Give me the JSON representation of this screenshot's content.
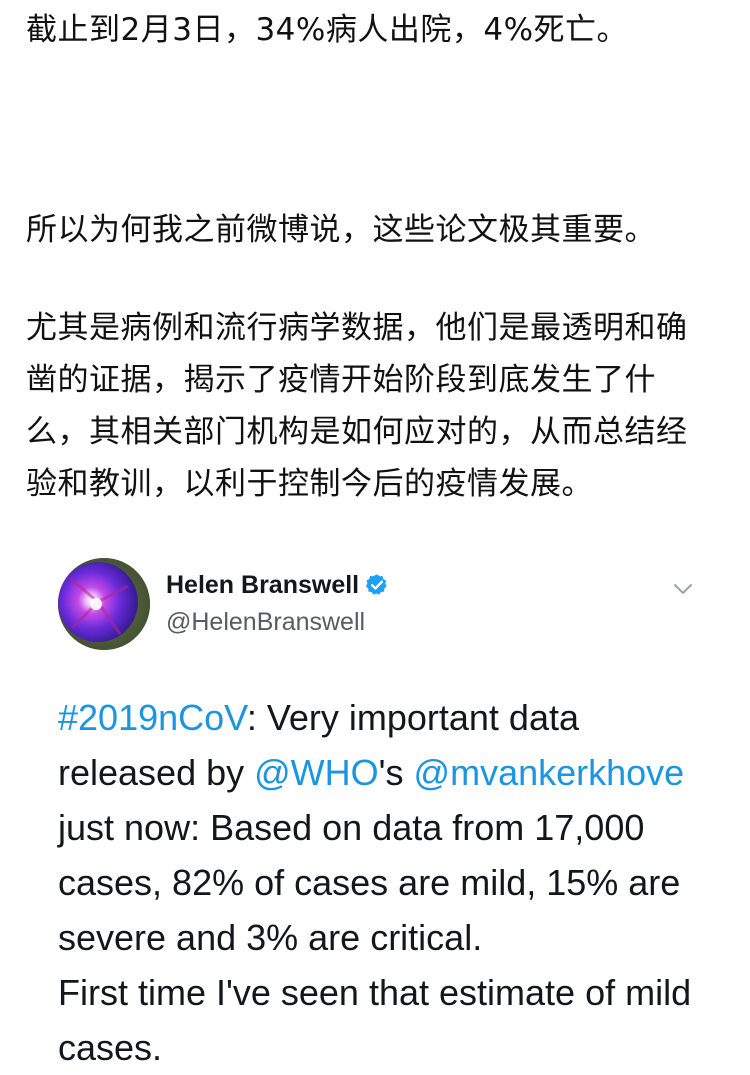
{
  "article": {
    "p1": "截止到2月3日，34%病人出院，4%死亡。",
    "p2": "所以为何我之前微博说，这些论文极其重要。",
    "p3": "尤其是病例和流行病学数据，他们是最透明和确凿的证据，揭示了疫情开始阶段到底发生了什么，其相关部门机构是如何应对的，从而总结经验和教训，以利于控制今后的疫情发展。"
  },
  "tweet": {
    "author_name": "Helen Branswell",
    "author_handle": "@HelenBranswell",
    "icons": {
      "avatar": "morning-glory-flower",
      "verified": "verified-badge-icon",
      "menu": "chevron-down-icon"
    },
    "body": {
      "hashtag": "#2019nCoV",
      "t1": ": Very important data released by ",
      "mention1": "@WHO",
      "t2": "'s ",
      "mention2": "@mvankerkhove",
      "t3": " just now: Based on data from 17,000 cases, 82% of cases are mild, 15% are severe and 3% are critical.",
      "t4": "First time I've seen that estimate of mild cases."
    }
  },
  "colors": {
    "link": "#1b95e0",
    "verified": "#1da1f2",
    "text": "#14171a",
    "handle": "#555c63"
  }
}
